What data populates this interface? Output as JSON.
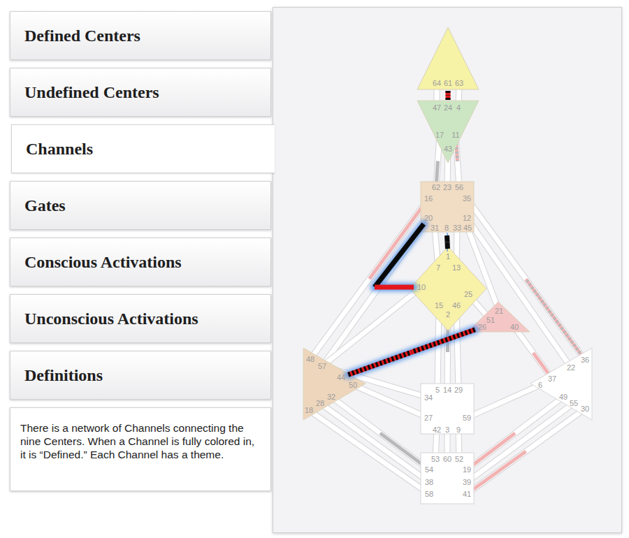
{
  "menu": {
    "items": [
      {
        "label": "Defined Centers",
        "selected": false
      },
      {
        "label": "Undefined Centers",
        "selected": false
      },
      {
        "label": "Channels",
        "selected": true
      },
      {
        "label": "Gates",
        "selected": false
      },
      {
        "label": "Conscious Activations",
        "selected": false
      },
      {
        "label": "Unconscious Activations",
        "selected": false
      },
      {
        "label": "Definitions",
        "selected": false
      }
    ]
  },
  "description": "There is a network of Channels connecting the nine Centers. When a Channel is fully colored in, it is “Defined.” Each Channel has a theme.",
  "centers": [
    {
      "gates": [
        "64",
        "61",
        "63"
      ],
      "defined": true,
      "color": "#f6f2a6"
    },
    {
      "gates": [
        "47",
        "24",
        "4",
        "17",
        "11",
        "43"
      ],
      "defined": true,
      "color": "#cce6c4"
    },
    {
      "gates": [
        "62",
        "23",
        "56",
        "16",
        "35",
        "20",
        "12",
        "31",
        "8",
        "33",
        "45"
      ],
      "defined": true,
      "color": "#f1dcc4"
    },
    {
      "gates": [
        "1",
        "7",
        "13",
        "10",
        "25",
        "15",
        "46",
        "2"
      ],
      "defined": true,
      "color": "#f8f1a8"
    },
    {
      "gates": [
        "21",
        "51",
        "26",
        "40"
      ],
      "defined": true,
      "color": "#f5c6c6"
    },
    {
      "gates": [
        "48",
        "57",
        "44",
        "50",
        "32",
        "28",
        "18"
      ],
      "defined": true,
      "color": "#eed6bc"
    },
    {
      "gates": [
        "36",
        "22",
        "37",
        "6",
        "49",
        "55",
        "30"
      ],
      "defined": false,
      "color": "#ffffff"
    },
    {
      "gates": [
        "5",
        "14",
        "29",
        "34",
        "27",
        "59",
        "42",
        "3",
        "9"
      ],
      "defined": false,
      "color": "#ffffff"
    },
    {
      "gates": [
        "53",
        "60",
        "52",
        "54",
        "19",
        "38",
        "39",
        "58",
        "41"
      ],
      "defined": false,
      "color": "#ffffff"
    }
  ],
  "channels": [
    {
      "defined": true,
      "gates": [
        {
          "gate": "20",
          "kind": "conscious"
        },
        {
          "gate": "10",
          "kind": "unconscious"
        }
      ]
    },
    {
      "defined": true,
      "gates": [
        {
          "gate": "61",
          "kind": "both"
        },
        {
          "gate": "24",
          "kind": "both"
        }
      ]
    },
    {
      "defined": true,
      "gates": [
        {
          "gate": "8",
          "kind": "conscious"
        },
        {
          "gate": "1",
          "kind": "conscious"
        }
      ]
    },
    {
      "defined": true,
      "gates": [
        {
          "gate": "26",
          "kind": "both"
        },
        {
          "gate": "44",
          "kind": "both"
        }
      ]
    },
    {
      "defined": false,
      "gates": [
        {
          "gate": "64",
          "kind": "none"
        },
        {
          "gate": "47",
          "kind": "none"
        }
      ]
    },
    {
      "defined": false,
      "gates": [
        {
          "gate": "63",
          "kind": "none"
        },
        {
          "gate": "4",
          "kind": "none"
        }
      ]
    },
    {
      "defined": false,
      "gates": [
        {
          "gate": "17",
          "kind": "none"
        },
        {
          "gate": "62",
          "kind": "conscious"
        }
      ]
    },
    {
      "defined": false,
      "gates": [
        {
          "gate": "43",
          "kind": "none"
        },
        {
          "gate": "23",
          "kind": "none"
        }
      ]
    },
    {
      "defined": false,
      "gates": [
        {
          "gate": "11",
          "kind": "both"
        },
        {
          "gate": "56",
          "kind": "none"
        }
      ]
    },
    {
      "defined": false,
      "gates": [
        {
          "gate": "16",
          "kind": "unconscious"
        },
        {
          "gate": "48",
          "kind": "none"
        }
      ]
    },
    {
      "defined": false,
      "gates": [
        {
          "gate": "20",
          "kind": "none"
        },
        {
          "gate": "57",
          "kind": "none"
        }
      ]
    },
    {
      "defined": false,
      "gates": [
        {
          "gate": "10",
          "kind": "none"
        },
        {
          "gate": "57",
          "kind": "none"
        }
      ]
    },
    {
      "defined": false,
      "gates": [
        {
          "gate": "34",
          "kind": "none"
        },
        {
          "gate": "57",
          "kind": "none"
        }
      ]
    },
    {
      "defined": false,
      "gates": [
        {
          "gate": "12",
          "kind": "none"
        },
        {
          "gate": "22",
          "kind": "none"
        }
      ]
    },
    {
      "defined": false,
      "gates": [
        {
          "gate": "35",
          "kind": "none"
        },
        {
          "gate": "36",
          "kind": "both"
        }
      ]
    },
    {
      "defined": false,
      "gates": [
        {
          "gate": "31",
          "kind": "none"
        },
        {
          "gate": "7",
          "kind": "none"
        }
      ]
    },
    {
      "defined": false,
      "gates": [
        {
          "gate": "33",
          "kind": "none"
        },
        {
          "gate": "13",
          "kind": "none"
        }
      ]
    },
    {
      "defined": false,
      "gates": [
        {
          "gate": "45",
          "kind": "none"
        },
        {
          "gate": "21",
          "kind": "none"
        }
      ]
    },
    {
      "defined": false,
      "gates": [
        {
          "gate": "25",
          "kind": "none"
        },
        {
          "gate": "51",
          "kind": "none"
        }
      ]
    },
    {
      "defined": false,
      "gates": [
        {
          "gate": "40",
          "kind": "none"
        },
        {
          "gate": "37",
          "kind": "unconscious"
        }
      ]
    },
    {
      "defined": false,
      "gates": [
        {
          "gate": "15",
          "kind": "none"
        },
        {
          "gate": "5",
          "kind": "none"
        }
      ]
    },
    {
      "defined": false,
      "gates": [
        {
          "gate": "2",
          "kind": "conscious"
        },
        {
          "gate": "14",
          "kind": "none"
        }
      ]
    },
    {
      "defined": false,
      "gates": [
        {
          "gate": "46",
          "kind": "none"
        },
        {
          "gate": "29",
          "kind": "none"
        }
      ]
    },
    {
      "defined": false,
      "gates": [
        {
          "gate": "27",
          "kind": "none"
        },
        {
          "gate": "50",
          "kind": "none"
        }
      ]
    },
    {
      "defined": false,
      "gates": [
        {
          "gate": "59",
          "kind": "none"
        },
        {
          "gate": "6",
          "kind": "none"
        }
      ]
    },
    {
      "defined": false,
      "gates": [
        {
          "gate": "42",
          "kind": "none"
        },
        {
          "gate": "53",
          "kind": "none"
        }
      ]
    },
    {
      "defined": false,
      "gates": [
        {
          "gate": "3",
          "kind": "none"
        },
        {
          "gate": "60",
          "kind": "none"
        }
      ]
    },
    {
      "defined": false,
      "gates": [
        {
          "gate": "9",
          "kind": "none"
        },
        {
          "gate": "52",
          "kind": "none"
        }
      ]
    },
    {
      "defined": false,
      "gates": [
        {
          "gate": "32",
          "kind": "none"
        },
        {
          "gate": "54",
          "kind": "conscious"
        }
      ]
    },
    {
      "defined": false,
      "gates": [
        {
          "gate": "28",
          "kind": "none"
        },
        {
          "gate": "38",
          "kind": "none"
        }
      ]
    },
    {
      "defined": false,
      "gates": [
        {
          "gate": "18",
          "kind": "none"
        },
        {
          "gate": "58",
          "kind": "none"
        }
      ]
    },
    {
      "defined": false,
      "gates": [
        {
          "gate": "49",
          "kind": "none"
        },
        {
          "gate": "19",
          "kind": "unconscious"
        }
      ]
    },
    {
      "defined": false,
      "gates": [
        {
          "gate": "55",
          "kind": "none"
        },
        {
          "gate": "39",
          "kind": "none"
        }
      ]
    },
    {
      "defined": false,
      "gates": [
        {
          "gate": "30",
          "kind": "none"
        },
        {
          "gate": "41",
          "kind": "unconscious"
        }
      ]
    }
  ]
}
